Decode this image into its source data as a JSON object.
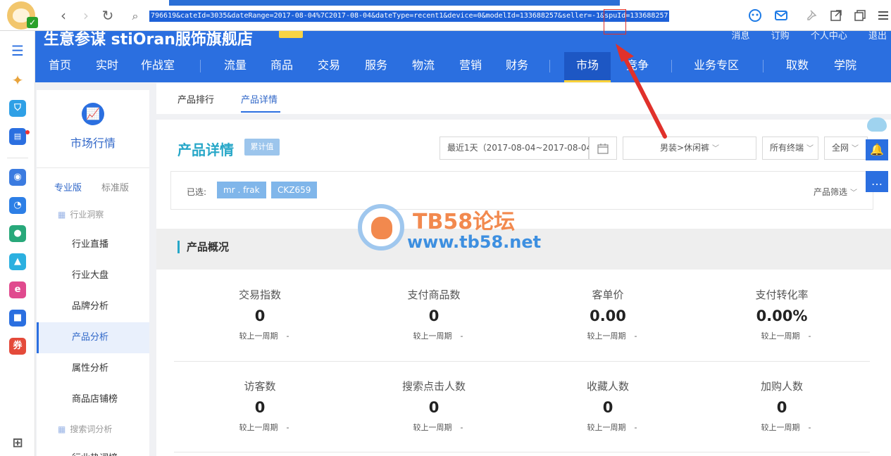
{
  "browser": {
    "url": "796619&cateId=3035&dateRange=2017-08-04%7C2017-08-04&dateType=recent1&device=0&modelId=133688257&seller=-1&spuId=133688257",
    "back_icon": "‹",
    "forward_icon": "›",
    "refresh_icon": "↻",
    "search_icon": "⌕"
  },
  "header": {
    "brand": "生意参谋  stiOran服饰旗舰店",
    "user_links": [
      "消息",
      "订购",
      "个人中心",
      "退出"
    ],
    "nav": [
      {
        "label": "首页"
      },
      {
        "label": "实时"
      },
      {
        "label": "作战室"
      },
      {
        "label": "流量"
      },
      {
        "label": "商品"
      },
      {
        "label": "交易"
      },
      {
        "label": "服务"
      },
      {
        "label": "物流"
      },
      {
        "label": "营销"
      },
      {
        "label": "财务"
      },
      {
        "label": "市场"
      },
      {
        "label": "竞争"
      },
      {
        "label": "业务专区"
      },
      {
        "label": "取数"
      },
      {
        "label": "学院"
      }
    ],
    "active_nav": "市场"
  },
  "sidebar": {
    "title": "市场行情",
    "versions": [
      "专业版",
      "标准版"
    ],
    "group1": "行业洞察",
    "items": [
      "行业直播",
      "行业大盘",
      "品牌分析",
      "产品分析",
      "属性分析",
      "商品店铺榜"
    ],
    "group2": "搜索词分析",
    "partial_item": "行业热词榜"
  },
  "subtabs": [
    "产品排行",
    "产品详情"
  ],
  "panel": {
    "title": "产品详情",
    "badge": "累计值",
    "date_filter": "最近1天（2017-08-04~2017-08-04）",
    "category_filter": "男装>休闲裤",
    "terminal_filter": "所有终端",
    "network_filter": "全网",
    "selected_label": "已选:",
    "tags": [
      "mr . frak",
      "CKZ659"
    ],
    "product_filter": "产品筛选"
  },
  "overview": {
    "title": "产品概况",
    "compare_label": "较上一周期",
    "compare_value": "-",
    "metrics": [
      {
        "label": "交易指数",
        "value": "0"
      },
      {
        "label": "支付商品数",
        "value": "0"
      },
      {
        "label": "客单价",
        "value": "0.00"
      },
      {
        "label": "支付转化率",
        "value": "0.00%"
      },
      {
        "label": "访客数",
        "value": "0"
      },
      {
        "label": "搜索点击人数",
        "value": "0"
      },
      {
        "label": "收藏人数",
        "value": "0"
      },
      {
        "label": "加购人数",
        "value": "0"
      }
    ]
  },
  "watermark": {
    "line1": "TB58论坛",
    "line2": "www.tb58.net"
  },
  "colors": {
    "primary": "#2b6fe0",
    "accent_teal": "#27a7c8",
    "tag": "#80b6ea",
    "highlight_red": "#e0312b"
  }
}
